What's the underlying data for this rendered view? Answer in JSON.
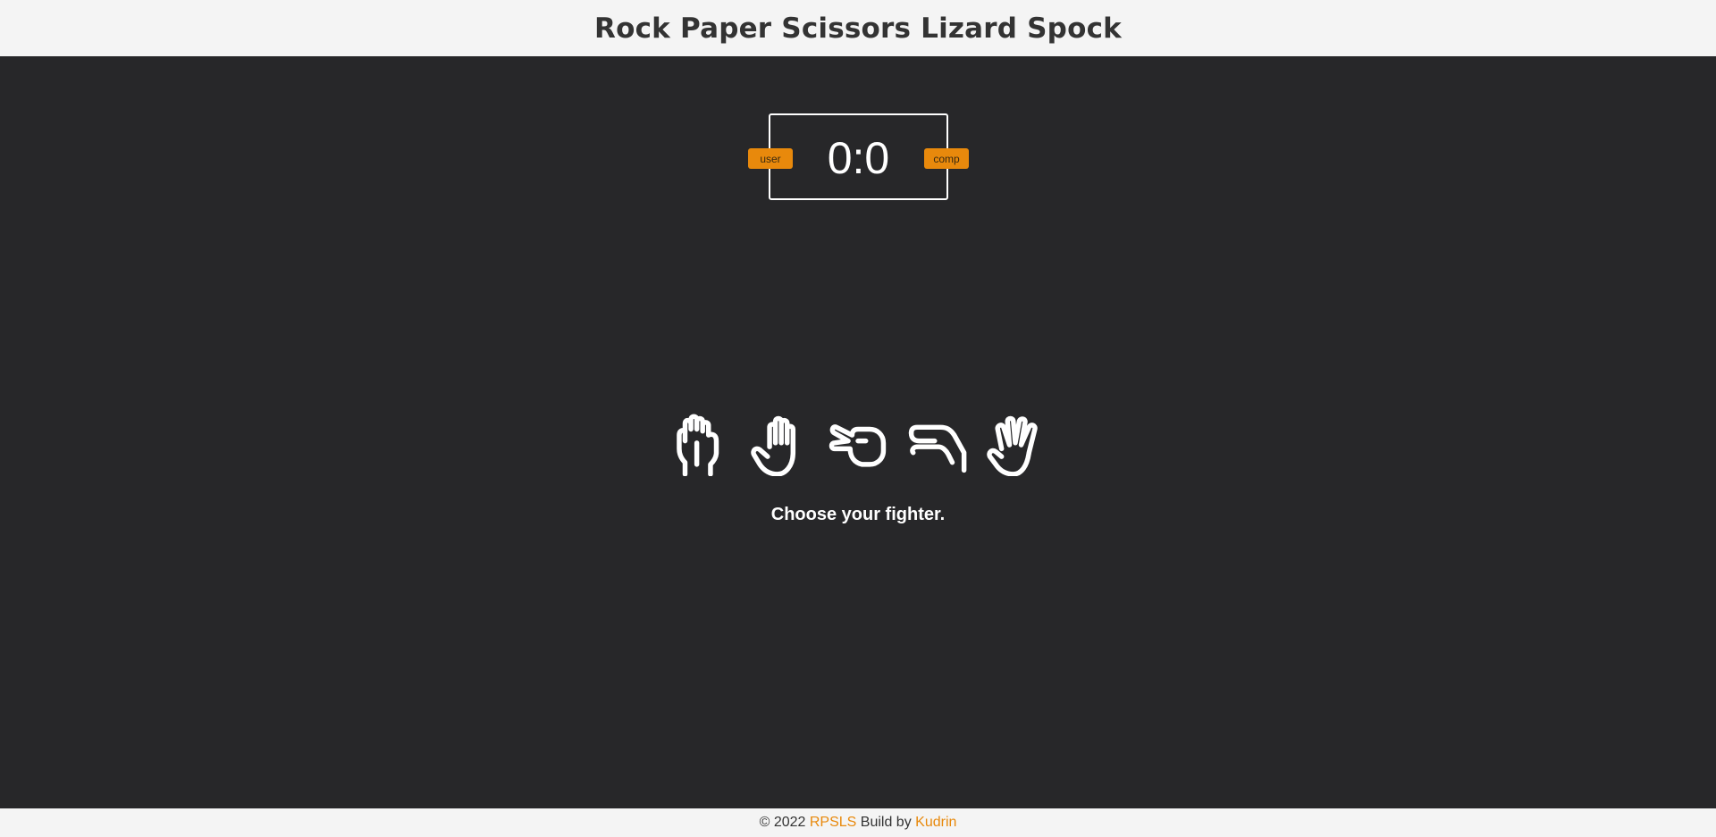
{
  "header": {
    "title": "Rock Paper Scissors Lizard Spock"
  },
  "scoreboard": {
    "score": "0:0",
    "user_label": "user",
    "comp_label": "comp"
  },
  "choices": [
    {
      "name": "rock",
      "icon": "hand-rock-icon"
    },
    {
      "name": "paper",
      "icon": "hand-paper-icon"
    },
    {
      "name": "scissors",
      "icon": "hand-scissors-icon"
    },
    {
      "name": "lizard",
      "icon": "hand-lizard-icon"
    },
    {
      "name": "spock",
      "icon": "hand-spock-icon"
    }
  ],
  "prompt": "Choose your fighter.",
  "footer": {
    "copyright": "© 2022",
    "app_link": "RPSLS",
    "build_by": "Build by",
    "author_link": "Kudrin"
  },
  "colors": {
    "background": "#272729",
    "bar": "#f4f4f4",
    "accent": "#e8890c",
    "text_dark": "#333333",
    "text_light": "#ffffff"
  }
}
